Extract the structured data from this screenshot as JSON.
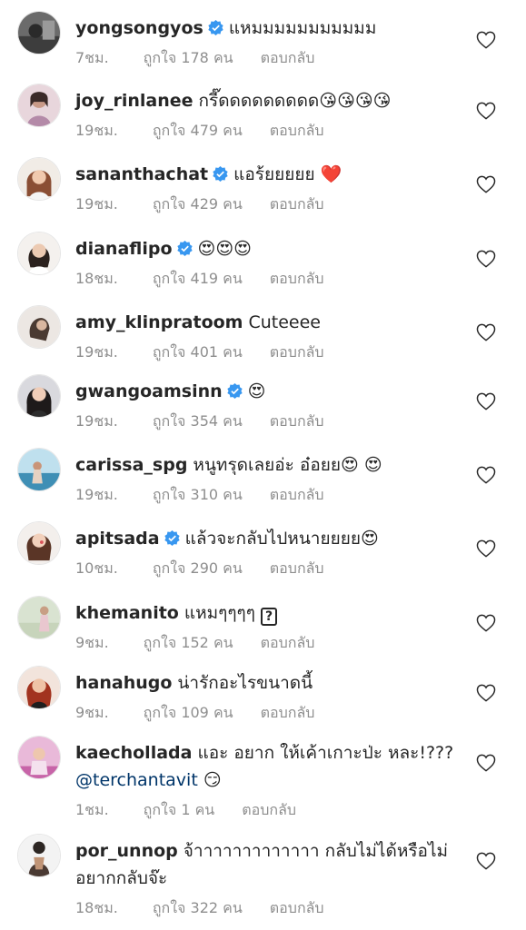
{
  "comments": [
    {
      "username": "yongsongyos",
      "verified": true,
      "text": "แหมมมมมมมมมมม",
      "time": "7ชม.",
      "likes": "ถูกใจ 178 คน",
      "reply": "ตอบกลับ"
    },
    {
      "username": "joy_rinlanee",
      "verified": false,
      "text": "กรี๊ดดดดดดดดด😘😘😘😘",
      "time": "19ชม.",
      "likes": "ถูกใจ 479 คน",
      "reply": "ตอบกลับ"
    },
    {
      "username": "sananthachat",
      "verified": true,
      "text": "แอร้ยยยยย ❤️",
      "time": "19ชม.",
      "likes": "ถูกใจ 429 คน",
      "reply": "ตอบกลับ"
    },
    {
      "username": "dianaflipo",
      "verified": true,
      "text": "😍😍😍",
      "time": "18ชม.",
      "likes": "ถูกใจ 419 คน",
      "reply": "ตอบกลับ"
    },
    {
      "username": "amy_klinpratoom",
      "verified": false,
      "text": "Cuteeee",
      "time": "19ชม.",
      "likes": "ถูกใจ 401 คน",
      "reply": "ตอบกลับ"
    },
    {
      "username": "gwangoamsinn",
      "verified": true,
      "text": "😍",
      "time": "19ชม.",
      "likes": "ถูกใจ 354 คน",
      "reply": "ตอบกลับ"
    },
    {
      "username": "carissa_spg",
      "verified": false,
      "text": "หนูทรุดเลยอ่ะ อ๋อยย😍 😍",
      "time": "19ชม.",
      "likes": "ถูกใจ 310 คน",
      "reply": "ตอบกลับ"
    },
    {
      "username": "apitsada",
      "verified": true,
      "text": "แล้วจะกลับไปหนายยยย😍",
      "time": "10ชม.",
      "likes": "ถูกใจ 290 คน",
      "reply": "ตอบกลับ"
    },
    {
      "username": "khemanito",
      "verified": false,
      "text": "แหมๆๆๆๆ",
      "time": "9ชม.",
      "likes": "ถูกใจ 152 คน",
      "reply": "ตอบกลับ"
    },
    {
      "username": "hanahugo",
      "verified": false,
      "text": "น่ารักอะไรขนาดนี้",
      "time": "9ชม.",
      "likes": "ถูกใจ 109 คน",
      "reply": "ตอบกลับ"
    },
    {
      "username": "kaechollada",
      "verified": false,
      "text": "แอะ อยาก ให้เค้าเกาะป่ะ หละ!???",
      "mention": "@terchantavit",
      "text_after": " 😏",
      "time": "1ชม.",
      "likes": "ถูกใจ 1 คน",
      "reply": "ตอบกลับ"
    },
    {
      "username": "por_unnop",
      "verified": false,
      "text": "จ้าาาาาาาาาาาาา กลับไม่ได้หรือไม่อยากกลับจ๊ะ",
      "time": "18ชม.",
      "likes": "ถูกใจ 322 คน",
      "reply": "ตอบกลับ"
    }
  ],
  "colors": {
    "verified": "#3897f0",
    "text": "#262626",
    "meta": "#8e8e8e",
    "mention": "#003569"
  }
}
